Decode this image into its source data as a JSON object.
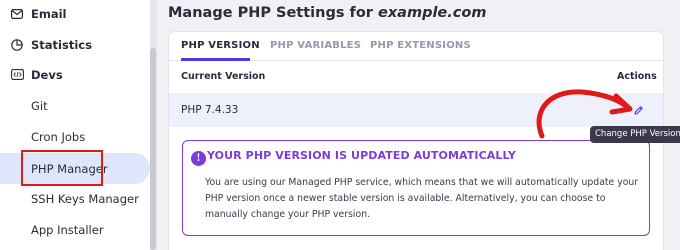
{
  "sidebar": {
    "items": [
      {
        "label": "Email",
        "icon": "email-icon"
      },
      {
        "label": "Statistics",
        "icon": "statistics-icon"
      },
      {
        "label": "Devs",
        "icon": "code-icon"
      },
      {
        "label": "Git"
      },
      {
        "label": "Cron Jobs"
      },
      {
        "label": "PHP Manager",
        "active": true
      },
      {
        "label": "SSH Keys Manager"
      },
      {
        "label": "App Installer"
      }
    ]
  },
  "main": {
    "title_prefix": "Manage PHP Settings for",
    "title_domain": "example.com",
    "tabs": [
      "PHP VERSION",
      "PHP VARIABLES",
      "PHP EXTENSIONS"
    ],
    "table": {
      "headers": [
        "Current Version",
        "Actions"
      ],
      "rows": [
        {
          "version": "PHP 7.4.33"
        }
      ]
    },
    "tooltip": "Change PHP Version",
    "notice": {
      "title": "YOUR PHP VERSION IS UPDATED AUTOMATICALLY",
      "icon_char": "!",
      "body": "You are using our Managed PHP service, which means that we will automatically update your PHP version once a newer stable version is available. Alternatively, you can choose to manually change your PHP version."
    }
  },
  "colors": {
    "accent": "#5333ed",
    "notice": "#7e3bd9",
    "annotation": "#e01919",
    "active_bg": "#dfe6fb"
  }
}
